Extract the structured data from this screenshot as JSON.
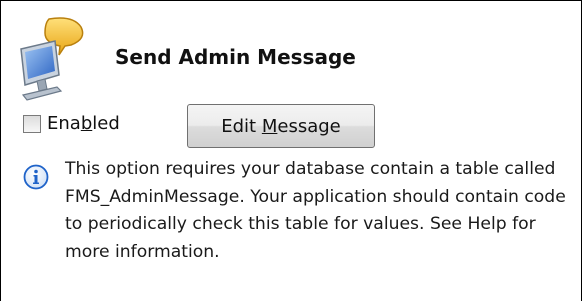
{
  "header": {
    "title": "Send Admin Message",
    "icon": "monitor-speech-bubble-icon"
  },
  "controls": {
    "enabled_checkbox": {
      "label_pre": "Ena",
      "label_mnemonic": "b",
      "label_post": "led",
      "checked": false
    },
    "edit_message_button": {
      "label_pre": "Edit ",
      "label_mnemonic": "M",
      "label_post": "essage"
    }
  },
  "info": {
    "icon": "info-icon",
    "text": "This option requires your database contain a table called FMS_AdminMessage. Your application should contain code to periodically check this table for values. See Help for more information."
  },
  "colors": {
    "border": "#000000",
    "info_icon_blue": "#1f63c9",
    "bubble_yellow": "#f5c22b",
    "screen_blue": "#3b78d8"
  }
}
